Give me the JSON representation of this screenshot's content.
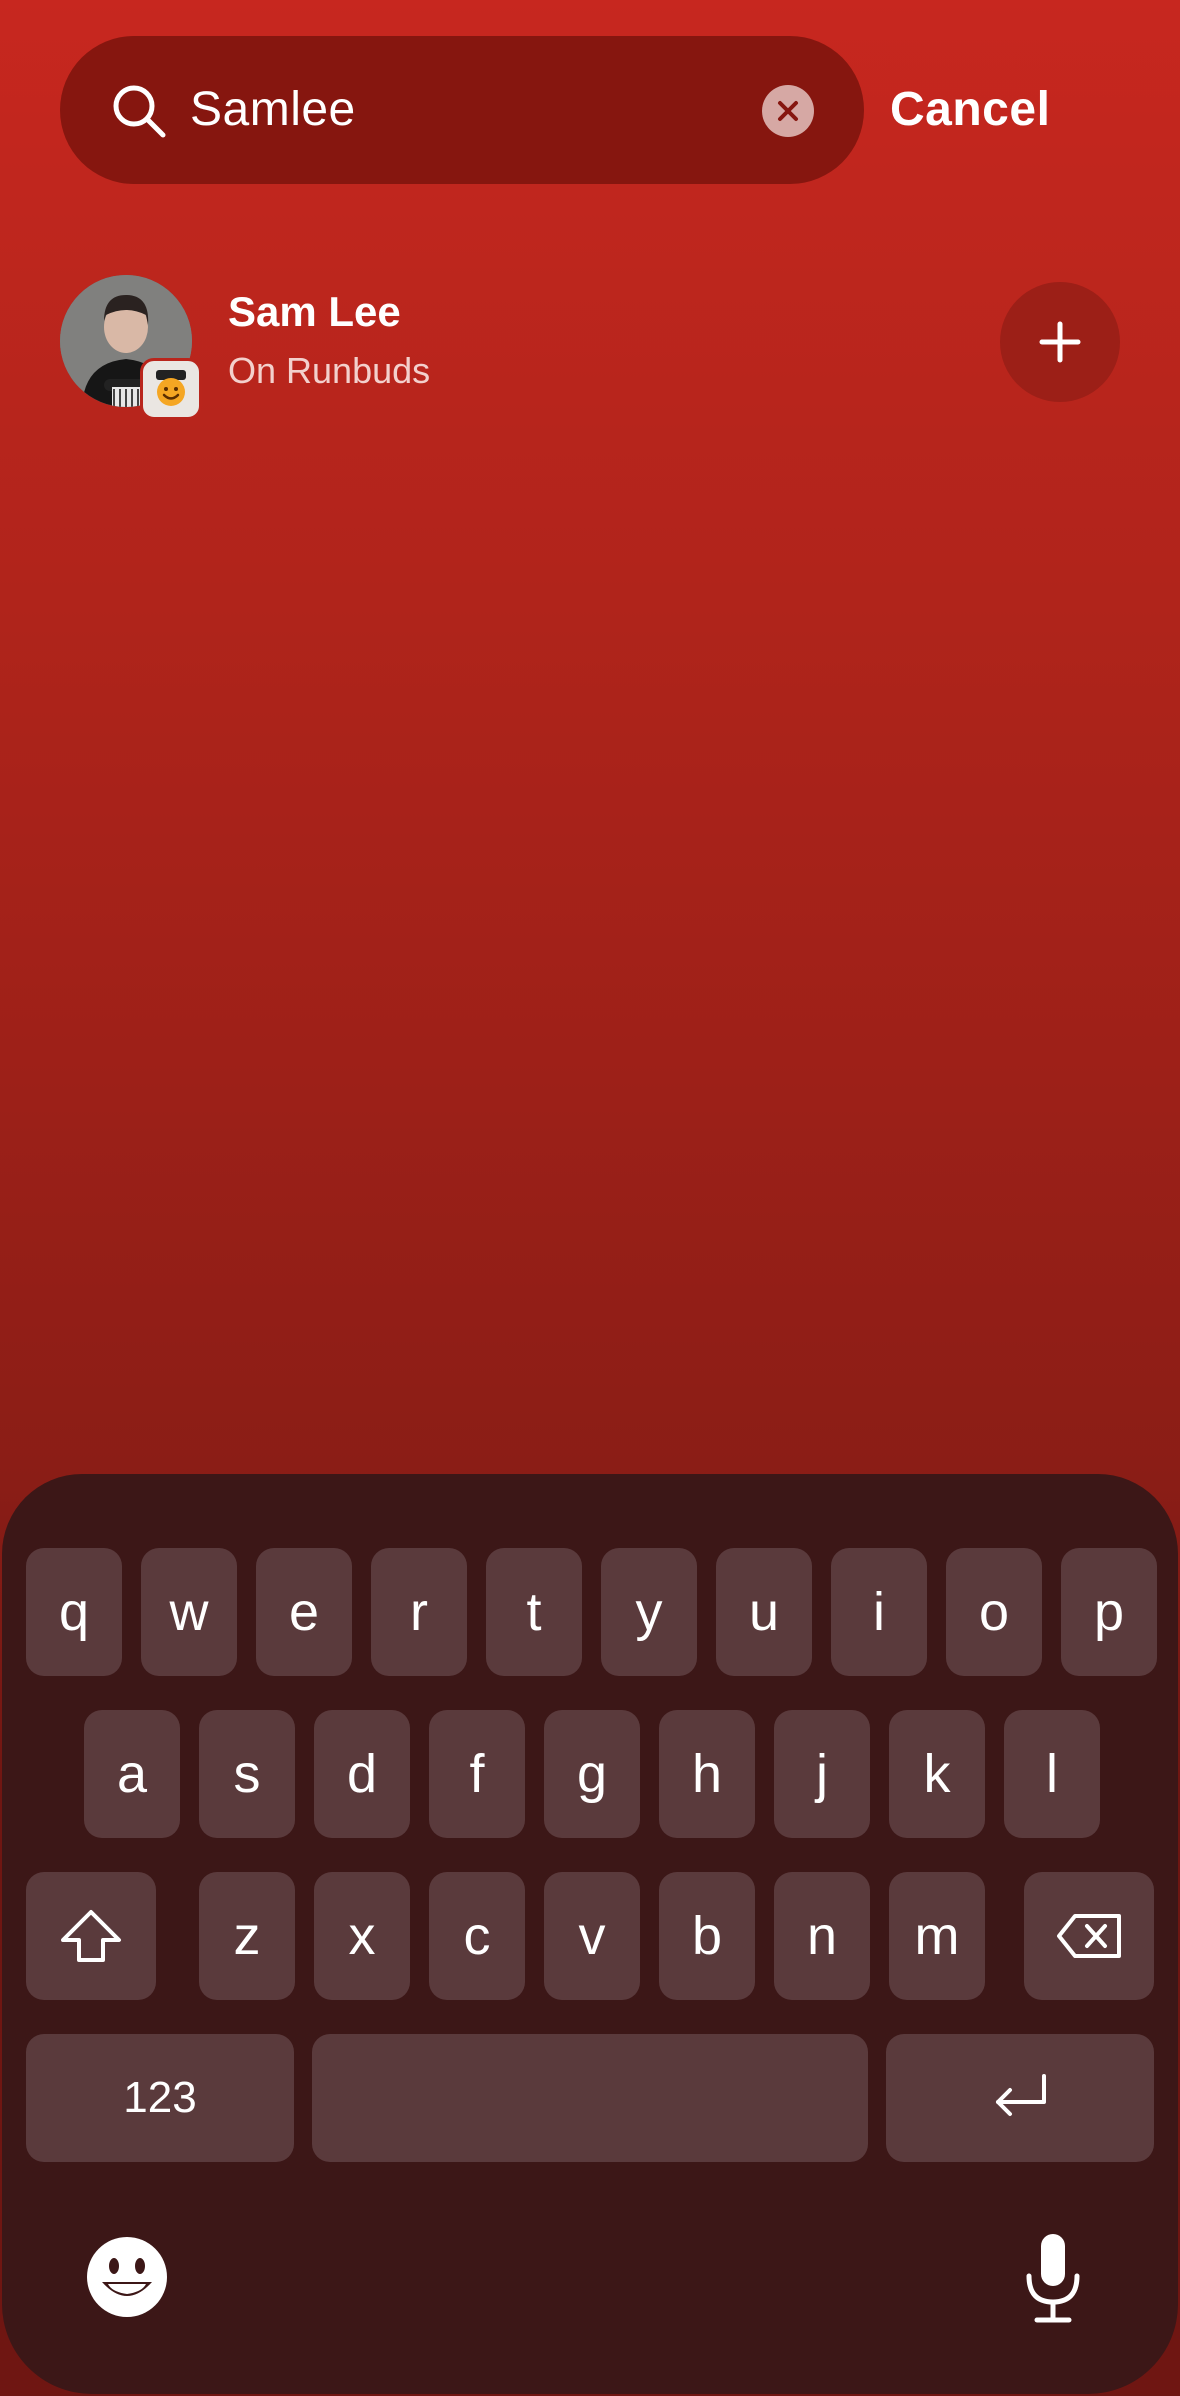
{
  "search": {
    "query": "Samlee",
    "cancel_label": "Cancel"
  },
  "results": [
    {
      "name": "Sam Lee",
      "status": "On Runbuds"
    }
  ],
  "keyboard": {
    "row1": [
      "q",
      "w",
      "e",
      "r",
      "t",
      "y",
      "u",
      "i",
      "o",
      "p"
    ],
    "row2": [
      "a",
      "s",
      "d",
      "f",
      "g",
      "h",
      "j",
      "k",
      "l"
    ],
    "row3": [
      "z",
      "x",
      "c",
      "v",
      "b",
      "n",
      "m"
    ],
    "numbers_label": "123"
  },
  "icons": {
    "search": "search-icon",
    "clear": "clear-icon",
    "add": "plus-icon",
    "shift": "shift-icon",
    "backspace": "backspace-icon",
    "return": "return-icon",
    "emoji": "emoji-icon",
    "mic": "microphone-icon"
  },
  "colors": {
    "background_top": "#c7271f",
    "search_field": "#86160f",
    "keyboard": "#3c1717",
    "key": "#5a3a3c"
  }
}
